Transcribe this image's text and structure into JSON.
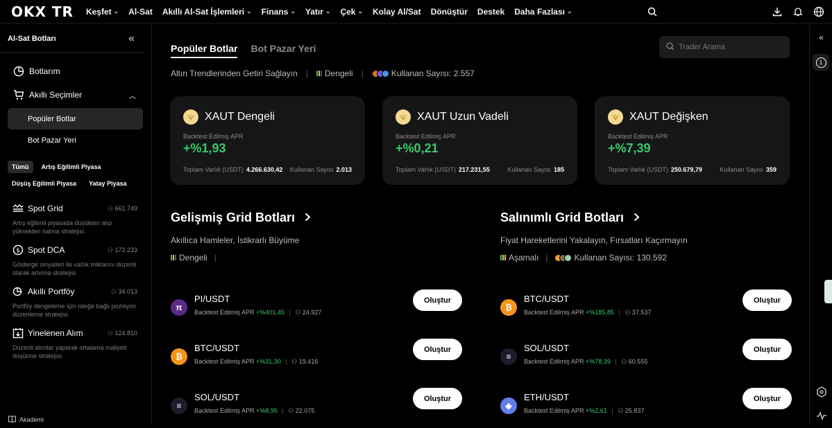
{
  "topbar": {
    "logo": "OKX TR",
    "nav": [
      {
        "label": "Keşfet",
        "chevron": true
      },
      {
        "label": "Al-Sat",
        "chevron": false
      },
      {
        "label": "Akıllı Al-Sat İşlemleri",
        "chevron": true
      },
      {
        "label": "Finans",
        "chevron": true
      },
      {
        "label": "Yatır",
        "chevron": true
      },
      {
        "label": "Çek",
        "chevron": true
      },
      {
        "label": "Kolay Al/Sat",
        "chevron": false
      },
      {
        "label": "Dönüştür",
        "chevron": false
      },
      {
        "label": "Destek",
        "chevron": false
      },
      {
        "label": "Daha Fazlası",
        "chevron": true
      }
    ],
    "icons": [
      "search-icon",
      "download-icon",
      "bell-icon",
      "globe-icon"
    ]
  },
  "sidebar": {
    "title": "Al-Sat Botları",
    "items": {
      "botlarim": "Botlarım",
      "akilli_secimler": "Akıllı Seçimler",
      "populer_botlar": "Popüler Botlar",
      "bot_pazar_yeri": "Bot Pazar Yeri"
    },
    "filters": {
      "tumu": "Tümü",
      "artis": "Artış Eğilimli Piyasa",
      "dusus": "Düşüş Eğilimli Piyasa",
      "yatay": "Yatay Piyasa"
    },
    "strategies": [
      {
        "name": "Spot Grid",
        "count": "661.749",
        "desc": "Artış eğilimli piyasada düşükten alıp yüksekten satma stratejisi."
      },
      {
        "name": "Spot DCA",
        "count": "172.233",
        "desc": "Gösterge sinyalleri ile varlık miktarını düzenli olarak artırma stratejisi."
      },
      {
        "name": "Akıllı Portföy",
        "count": "34.013",
        "desc": "Portföy dengeleme için isteğe bağlı pozisyon düzenleme stratejisi."
      },
      {
        "name": "Yinelenen Alım",
        "count": "124.810",
        "desc": "Düzenli alımlar yaparak ortalama maliyeti düşürme stratejisi."
      }
    ],
    "footer": "Akademi"
  },
  "main": {
    "tabs": {
      "populer": "Popüler Botlar",
      "pazar": "Bot Pazar Yeri"
    },
    "search_placeholder": "Trader Arama",
    "meta": {
      "desc": "Altın Trendlerinden Getiri Sağlayın",
      "risk": "Dengeli",
      "users": "Kullanan Sayısı: 2.557"
    },
    "cards": [
      {
        "title": "XAUT Dengeli",
        "apr_label": "Backtest Edilmiş APR",
        "apr": "+%1,93",
        "total_label": "Toplam Varlık (USDT)",
        "total": "4.266.630,42",
        "users_label": "Kullanan Sayısı",
        "users": "2.013"
      },
      {
        "title": "XAUT Uzun Vadeli",
        "apr_label": "Backtest Edilmiş APR",
        "apr": "+%0,21",
        "total_label": "Toplam Varlık (USDT)",
        "total": "217.231,55",
        "users_label": "Kullanan Sayısı",
        "users": "185"
      },
      {
        "title": "XAUT Değişken",
        "apr_label": "Backtest Edilmiş APR",
        "apr": "+%7,39",
        "total_label": "Toplam Varlık (USDT)",
        "total": "250.679,79",
        "users_label": "Kullanan Sayısı",
        "users": "359"
      }
    ],
    "sections": {
      "grid": {
        "title": "Gelişmiş Grid Botları",
        "subtitle": "Akıllıca Hamleler, İstikrarlı Büyüme",
        "risk": "Dengeli",
        "pairs": [
          {
            "name": "PI/USDT",
            "apr_label": "Backtest Edilmiş APR",
            "apr": "+%401,45",
            "users": "24.927",
            "coin": "pi",
            "button": "Oluştur"
          },
          {
            "name": "BTC/USDT",
            "apr_label": "Backtest Edilmiş APR",
            "apr": "+%31,30",
            "users": "19.416",
            "coin": "btc",
            "button": "Oluştur"
          },
          {
            "name": "SOL/USDT",
            "apr_label": "Backtest Edilmiş APR",
            "apr": "+%8,95",
            "users": "22.075",
            "coin": "sol",
            "button": "Oluştur"
          }
        ]
      },
      "salinimli": {
        "title": "Salınımlı Grid Botları",
        "subtitle": "Fiyat Hareketlerini Yakalayın, Fırsatları Kaçırmayın",
        "risk": "Aşamalı",
        "users": "Kullanan Sayısı: 130.592",
        "pairs": [
          {
            "name": "BTC/USDT",
            "apr_label": "Backtest Edilmiş APR",
            "apr": "+%185,85",
            "users": "37.537",
            "coin": "btc",
            "button": "Oluştur"
          },
          {
            "name": "SOL/USDT",
            "apr_label": "Backtest Edilmiş APR",
            "apr": "+%78,39",
            "users": "60.555",
            "coin": "sol",
            "button": "Oluştur"
          },
          {
            "name": "ETH/USDT",
            "apr_label": "Backtest Edilmiş APR",
            "apr": "+%2,61",
            "users": "25.837",
            "coin": "eth",
            "button": "Oluştur"
          }
        ]
      }
    }
  },
  "rightrail": {
    "badge": "1"
  },
  "colors": {
    "green": "#38c96b",
    "card_bg": "#161616",
    "gold": "#f3d990"
  }
}
